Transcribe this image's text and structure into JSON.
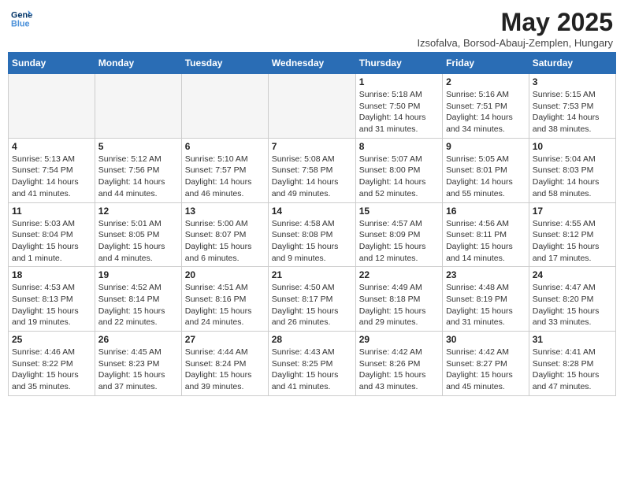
{
  "header": {
    "logo_line1": "General",
    "logo_line2": "Blue",
    "month_year": "May 2025",
    "location": "Izsofalva, Borsod-Abauj-Zemplen, Hungary"
  },
  "days_of_week": [
    "Sunday",
    "Monday",
    "Tuesday",
    "Wednesday",
    "Thursday",
    "Friday",
    "Saturday"
  ],
  "weeks": [
    [
      {
        "day": "",
        "info": ""
      },
      {
        "day": "",
        "info": ""
      },
      {
        "day": "",
        "info": ""
      },
      {
        "day": "",
        "info": ""
      },
      {
        "day": "1",
        "info": "Sunrise: 5:18 AM\nSunset: 7:50 PM\nDaylight: 14 hours\nand 31 minutes."
      },
      {
        "day": "2",
        "info": "Sunrise: 5:16 AM\nSunset: 7:51 PM\nDaylight: 14 hours\nand 34 minutes."
      },
      {
        "day": "3",
        "info": "Sunrise: 5:15 AM\nSunset: 7:53 PM\nDaylight: 14 hours\nand 38 minutes."
      }
    ],
    [
      {
        "day": "4",
        "info": "Sunrise: 5:13 AM\nSunset: 7:54 PM\nDaylight: 14 hours\nand 41 minutes."
      },
      {
        "day": "5",
        "info": "Sunrise: 5:12 AM\nSunset: 7:56 PM\nDaylight: 14 hours\nand 44 minutes."
      },
      {
        "day": "6",
        "info": "Sunrise: 5:10 AM\nSunset: 7:57 PM\nDaylight: 14 hours\nand 46 minutes."
      },
      {
        "day": "7",
        "info": "Sunrise: 5:08 AM\nSunset: 7:58 PM\nDaylight: 14 hours\nand 49 minutes."
      },
      {
        "day": "8",
        "info": "Sunrise: 5:07 AM\nSunset: 8:00 PM\nDaylight: 14 hours\nand 52 minutes."
      },
      {
        "day": "9",
        "info": "Sunrise: 5:05 AM\nSunset: 8:01 PM\nDaylight: 14 hours\nand 55 minutes."
      },
      {
        "day": "10",
        "info": "Sunrise: 5:04 AM\nSunset: 8:03 PM\nDaylight: 14 hours\nand 58 minutes."
      }
    ],
    [
      {
        "day": "11",
        "info": "Sunrise: 5:03 AM\nSunset: 8:04 PM\nDaylight: 15 hours\nand 1 minute."
      },
      {
        "day": "12",
        "info": "Sunrise: 5:01 AM\nSunset: 8:05 PM\nDaylight: 15 hours\nand 4 minutes."
      },
      {
        "day": "13",
        "info": "Sunrise: 5:00 AM\nSunset: 8:07 PM\nDaylight: 15 hours\nand 6 minutes."
      },
      {
        "day": "14",
        "info": "Sunrise: 4:58 AM\nSunset: 8:08 PM\nDaylight: 15 hours\nand 9 minutes."
      },
      {
        "day": "15",
        "info": "Sunrise: 4:57 AM\nSunset: 8:09 PM\nDaylight: 15 hours\nand 12 minutes."
      },
      {
        "day": "16",
        "info": "Sunrise: 4:56 AM\nSunset: 8:11 PM\nDaylight: 15 hours\nand 14 minutes."
      },
      {
        "day": "17",
        "info": "Sunrise: 4:55 AM\nSunset: 8:12 PM\nDaylight: 15 hours\nand 17 minutes."
      }
    ],
    [
      {
        "day": "18",
        "info": "Sunrise: 4:53 AM\nSunset: 8:13 PM\nDaylight: 15 hours\nand 19 minutes."
      },
      {
        "day": "19",
        "info": "Sunrise: 4:52 AM\nSunset: 8:14 PM\nDaylight: 15 hours\nand 22 minutes."
      },
      {
        "day": "20",
        "info": "Sunrise: 4:51 AM\nSunset: 8:16 PM\nDaylight: 15 hours\nand 24 minutes."
      },
      {
        "day": "21",
        "info": "Sunrise: 4:50 AM\nSunset: 8:17 PM\nDaylight: 15 hours\nand 26 minutes."
      },
      {
        "day": "22",
        "info": "Sunrise: 4:49 AM\nSunset: 8:18 PM\nDaylight: 15 hours\nand 29 minutes."
      },
      {
        "day": "23",
        "info": "Sunrise: 4:48 AM\nSunset: 8:19 PM\nDaylight: 15 hours\nand 31 minutes."
      },
      {
        "day": "24",
        "info": "Sunrise: 4:47 AM\nSunset: 8:20 PM\nDaylight: 15 hours\nand 33 minutes."
      }
    ],
    [
      {
        "day": "25",
        "info": "Sunrise: 4:46 AM\nSunset: 8:22 PM\nDaylight: 15 hours\nand 35 minutes."
      },
      {
        "day": "26",
        "info": "Sunrise: 4:45 AM\nSunset: 8:23 PM\nDaylight: 15 hours\nand 37 minutes."
      },
      {
        "day": "27",
        "info": "Sunrise: 4:44 AM\nSunset: 8:24 PM\nDaylight: 15 hours\nand 39 minutes."
      },
      {
        "day": "28",
        "info": "Sunrise: 4:43 AM\nSunset: 8:25 PM\nDaylight: 15 hours\nand 41 minutes."
      },
      {
        "day": "29",
        "info": "Sunrise: 4:42 AM\nSunset: 8:26 PM\nDaylight: 15 hours\nand 43 minutes."
      },
      {
        "day": "30",
        "info": "Sunrise: 4:42 AM\nSunset: 8:27 PM\nDaylight: 15 hours\nand 45 minutes."
      },
      {
        "day": "31",
        "info": "Sunrise: 4:41 AM\nSunset: 8:28 PM\nDaylight: 15 hours\nand 47 minutes."
      }
    ]
  ]
}
